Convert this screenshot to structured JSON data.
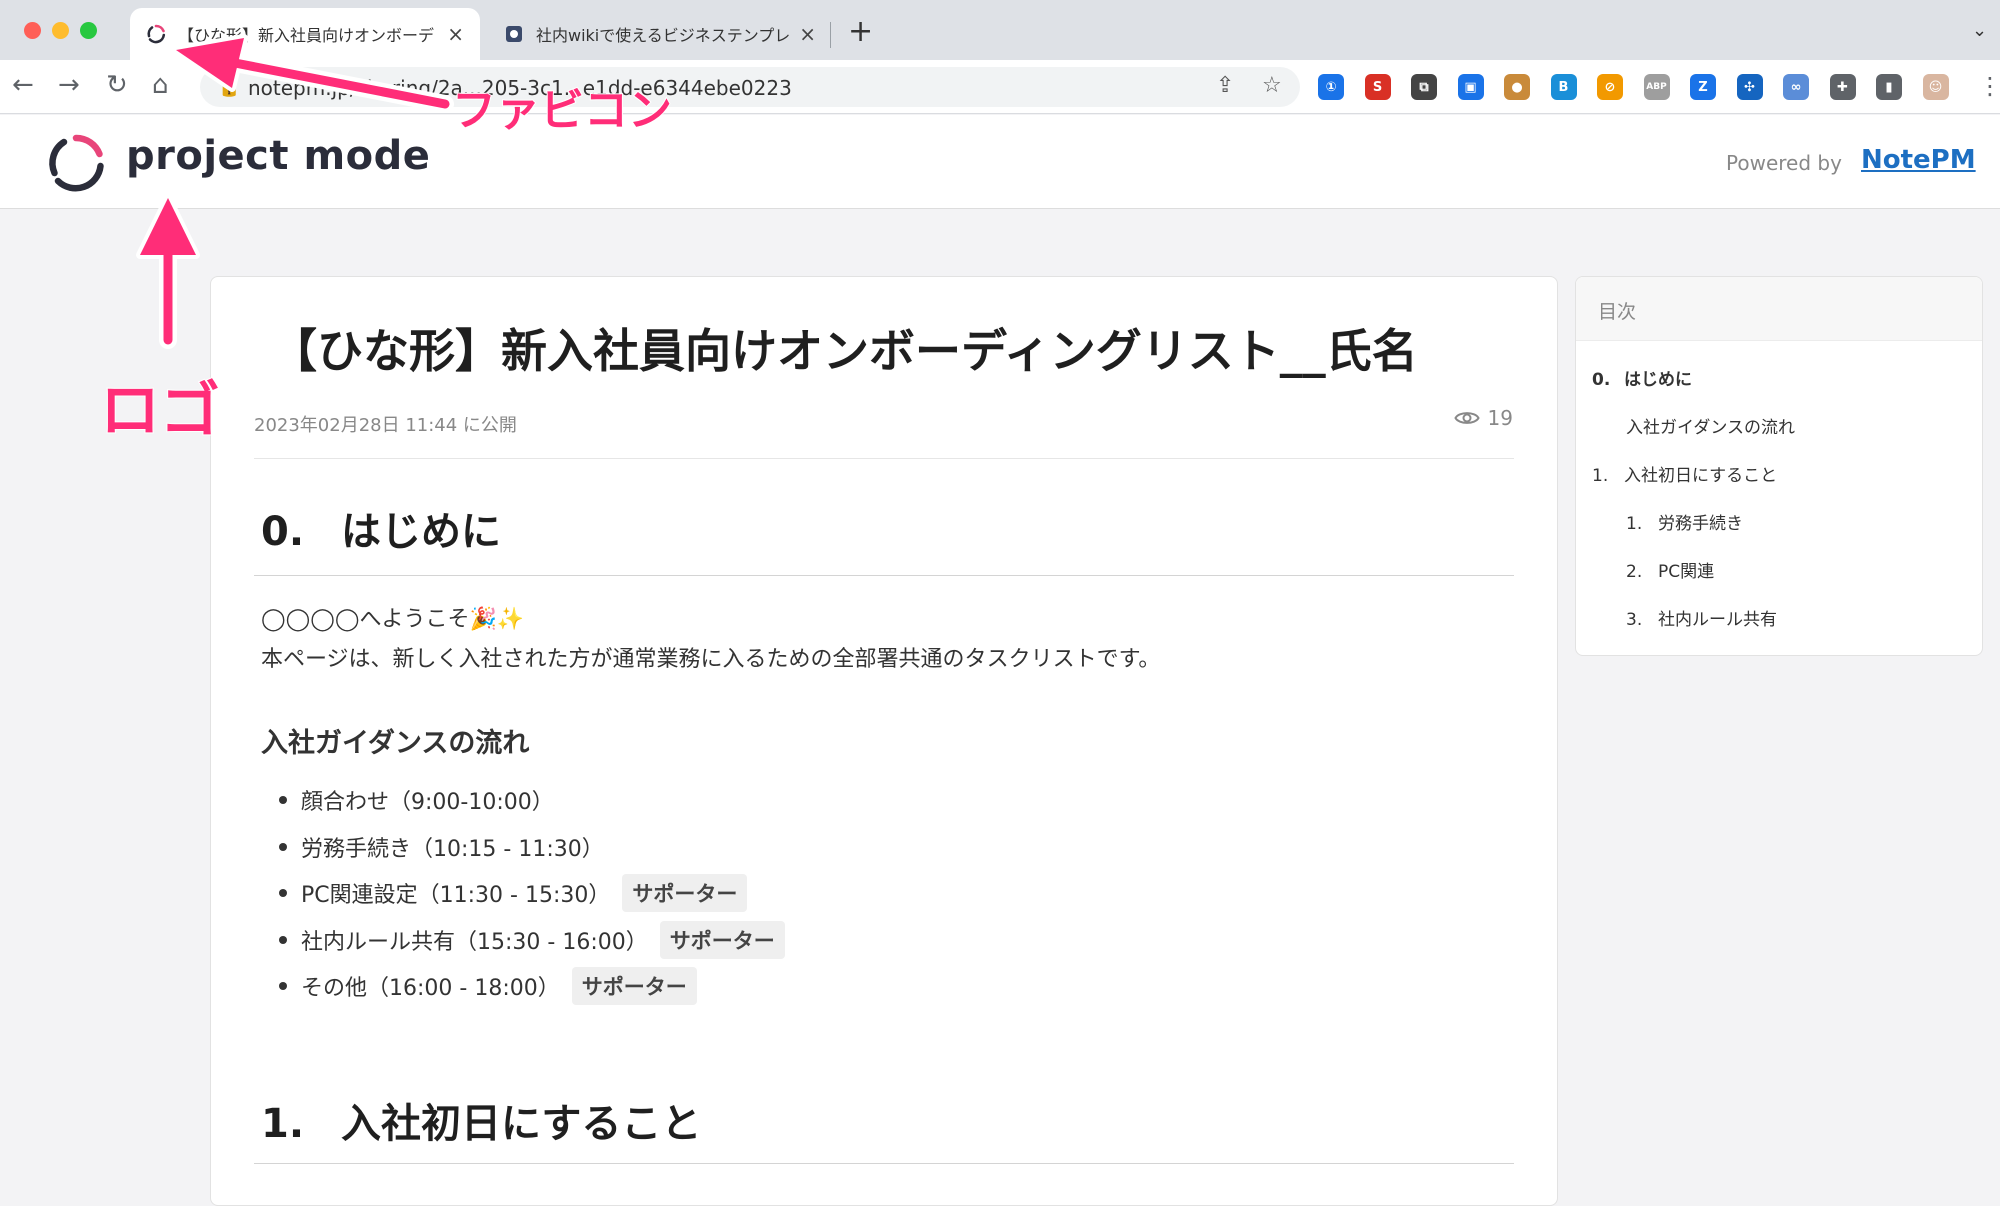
{
  "browser": {
    "tabs": [
      {
        "title": "【ひな形】新入社員向けオンボーデ",
        "active": true
      },
      {
        "title": "社内wikiで使えるビジネステンプレ",
        "active": false
      }
    ],
    "close_glyph": "×",
    "new_tab_glyph": "+",
    "tab_menu_glyph": "⌄",
    "url": "notepm.jp/sharing/2a...205-3c1...e1dd-e6344ebe0223",
    "nav": {
      "back": "←",
      "forward": "→",
      "reload": "↻",
      "home": "⌂"
    },
    "extensions": [
      {
        "name": "onepassword-icon",
        "label": "①",
        "color": "#1a73e8"
      },
      {
        "name": "seo-icon",
        "label": "S",
        "color": "#d93025"
      },
      {
        "name": "copy-icon",
        "label": "⧉",
        "color": "#444444"
      },
      {
        "name": "screenshot-icon",
        "label": "▣",
        "color": "#1a73e8"
      },
      {
        "name": "cookie-icon",
        "label": "●",
        "color": "#c98a3a"
      },
      {
        "name": "bi-icon",
        "label": "B",
        "color": "#1a8fd8"
      },
      {
        "name": "block-icon",
        "label": "⊘",
        "color": "#f29900"
      },
      {
        "name": "abp-icon",
        "label": "ABP",
        "color": "#9e9e9e"
      },
      {
        "name": "z-icon",
        "label": "Z",
        "color": "#1a73e8"
      },
      {
        "name": "network-icon",
        "label": "✣",
        "color": "#1565c0"
      },
      {
        "name": "link-icon",
        "label": "∞",
        "color": "#5b8dd8"
      },
      {
        "name": "puzzle-icon",
        "label": "✚",
        "color": "#5f6368"
      },
      {
        "name": "sidepanel-icon",
        "label": "▮",
        "color": "#5f6368"
      },
      {
        "name": "profile-icon",
        "label": "☺",
        "color": "#d9b6a0"
      }
    ],
    "more_glyph": "⋮"
  },
  "header": {
    "logo_text": "project mode",
    "powered_by": "Powered by",
    "notepm": "NotePM"
  },
  "article": {
    "title": "【ひな形】新入社員向けオンボーディングリスト__氏名",
    "published": "2023年02月28日 11:44 に公開",
    "views": "19",
    "section0": {
      "num": "0.",
      "title": "はじめに"
    },
    "welcome": "◯◯◯◯へようこそ🎉✨",
    "intro": "本ページは、新しく入社された方が通常業務に入るための全部署共通のタスクリストです。",
    "guidance_title": "入社ガイダンスの流れ",
    "schedule": [
      {
        "text": "顔合わせ（9:00-10:00）",
        "badge": ""
      },
      {
        "text": "労務手続き（10:15 - 11:30）",
        "badge": ""
      },
      {
        "text": "PC関連設定（11:30 - 15:30）",
        "badge": "サポーター"
      },
      {
        "text": "社内ルール共有（15:30 - 16:00）",
        "badge": "サポーター"
      },
      {
        "text": "その他（16:00 - 18:00）",
        "badge": "サポーター"
      }
    ],
    "section1": {
      "num": "1.",
      "title": "入社初日にすること"
    }
  },
  "toc": {
    "title": "目次",
    "items": [
      {
        "num": "0.",
        "label": "はじめに"
      },
      {
        "num": "",
        "label": "入社ガイダンスの流れ"
      },
      {
        "num": "1.",
        "label": "入社初日にすること"
      },
      {
        "num": "1.",
        "label": "労務手続き"
      },
      {
        "num": "2.",
        "label": "PC関連"
      },
      {
        "num": "3.",
        "label": "社内ルール共有"
      }
    ]
  },
  "annotations": {
    "favicon_label": "ファビコン",
    "logo_label": "ロゴ",
    "color": "#ff2d78"
  }
}
